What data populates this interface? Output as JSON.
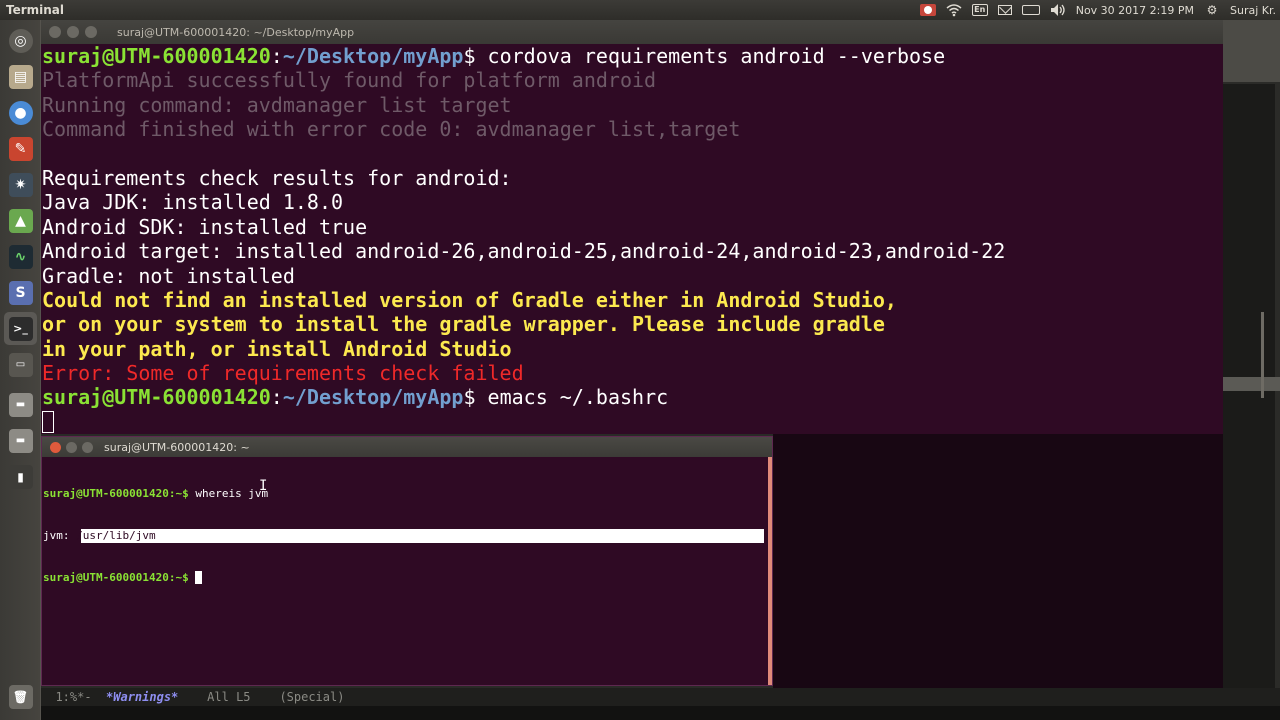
{
  "top_panel": {
    "app_title": "Terminal",
    "datetime": "Nov 30 2017  2:19 PM",
    "user": "Suraj Kr.",
    "tray_icons": [
      "record-icon",
      "wifi-icon",
      "keyboard-icon",
      "mail-icon",
      "battery-icon",
      "volume-icon",
      "settings-gear-icon"
    ]
  },
  "launcher": {
    "items": [
      "dash-home",
      "files",
      "chrome",
      "tools",
      "network",
      "android-studio",
      "system-monitor",
      "sublime-text",
      "terminal",
      "device",
      "drive-1",
      "drive-2",
      "usb",
      "trash"
    ]
  },
  "big_terminal": {
    "title": "suraj@UTM-600001420: ~/Desktop/myApp",
    "lines": [
      {
        "user": "suraj@UTM-600001420",
        "sep": ":",
        "path": "~/Desktop/myApp",
        "dollar": "$ ",
        "cmd": "cordova requirements android --verbose"
      },
      {
        "muted": "PlatformApi successfully found for platform android"
      },
      {
        "muted": "Running command: avdmanager list target"
      },
      {
        "muted": "Command finished with error code 0: avdmanager list,target"
      },
      {
        "blank": ""
      },
      {
        "text": "Requirements check results for android:"
      },
      {
        "text": "Java JDK: installed 1.8.0"
      },
      {
        "text": "Android SDK: installed true"
      },
      {
        "text": "Android target: installed android-26,android-25,android-24,android-23,android-22"
      },
      {
        "text": "Gradle: not installed"
      },
      {
        "warn": "Could not find an installed version of Gradle either in Android Studio,"
      },
      {
        "warn": "or on your system to install the gradle wrapper. Please include gradle"
      },
      {
        "warn": "in your path, or install Android Studio"
      },
      {
        "err": "Error: Some of requirements check failed"
      },
      {
        "user": "suraj@UTM-600001420",
        "sep": ":",
        "path": "~/Desktop/myApp",
        "dollar": "$ ",
        "cmd": "emacs ~/.bashrc"
      }
    ]
  },
  "small_terminal": {
    "title": "suraj@UTM-600001420: ~",
    "line1_prompt": "suraj@UTM-600001420:~$ ",
    "line1_cmd": "whereis jvm",
    "line2_label": "jvm: ",
    "line2_selected": "/usr/lib/jvm",
    "line3_prompt": "suraj@UTM-600001420:~$ "
  },
  "emacs_modeline": {
    "left": "  1:%*-  ",
    "warnings": "*Warnings*",
    "middle": "    All L5    ",
    "mode": "(Special)"
  }
}
